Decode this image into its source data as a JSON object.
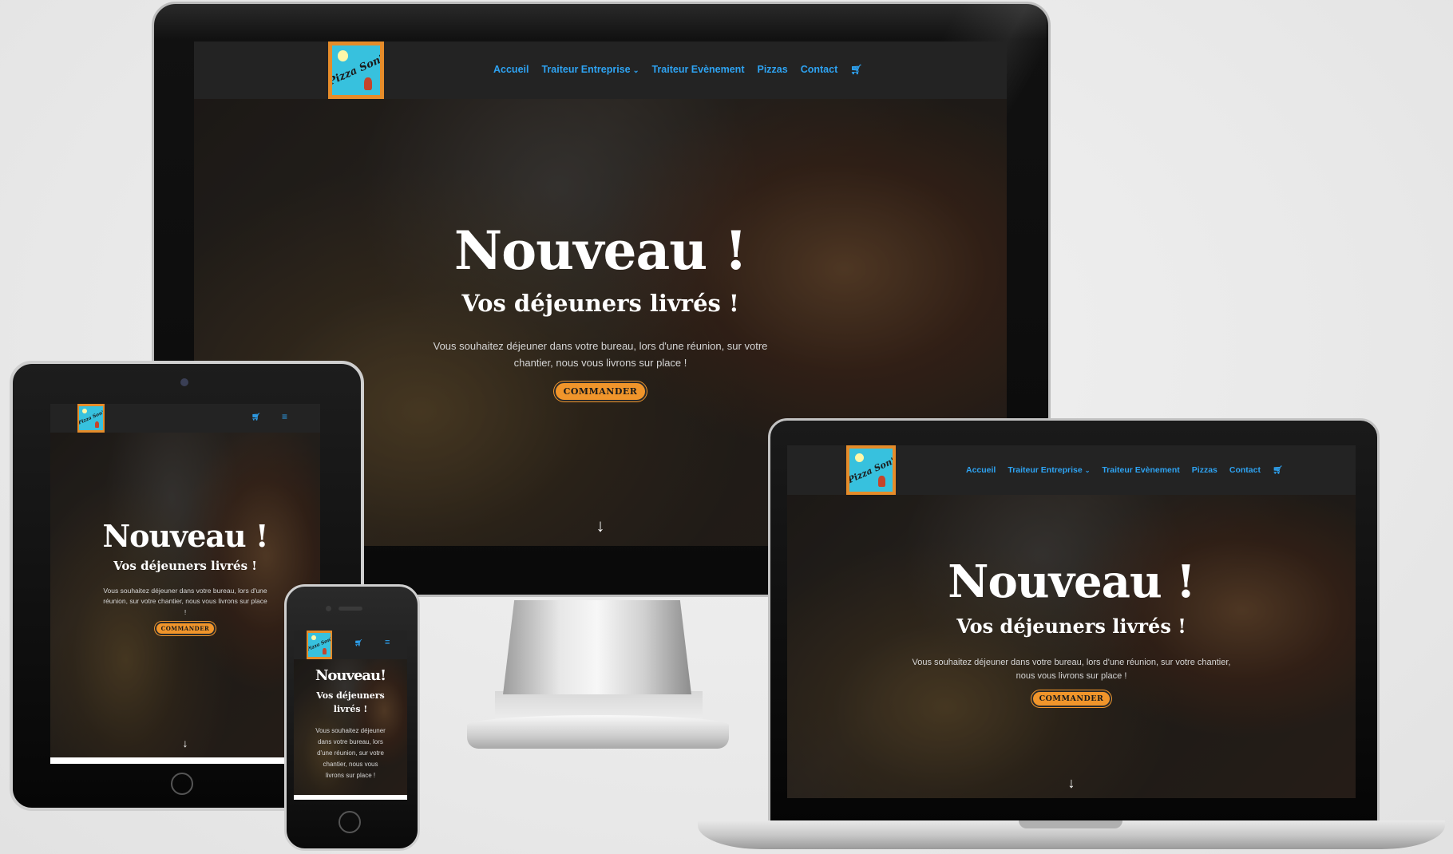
{
  "brand": {
    "logo_text": "Pizza Son'"
  },
  "nav": {
    "items": [
      {
        "label": "Accueil"
      },
      {
        "label": "Traiteur Entreprise",
        "has_dropdown": true
      },
      {
        "label": "Traiteur Evènement"
      },
      {
        "label": "Pizzas"
      },
      {
        "label": "Contact"
      }
    ],
    "cart_icon": "cart-icon",
    "menu_icon": "hamburger-menu-icon"
  },
  "hero": {
    "title": "Nouveau !",
    "title_phone": "Nouveau!",
    "subtitle": "Vos déjeuners livrés !",
    "text": "Vous souhaitez déjeuner dans votre bureau, lors d'une réunion, sur votre chantier, nous vous livrons sur place !",
    "button_label": "COMMANDER",
    "scroll_arrow": "↓"
  },
  "colors": {
    "accent": "#2ea3f2",
    "button": "#f0952b",
    "nav_bg": "#232323",
    "logo_bg": "#37c1de"
  }
}
